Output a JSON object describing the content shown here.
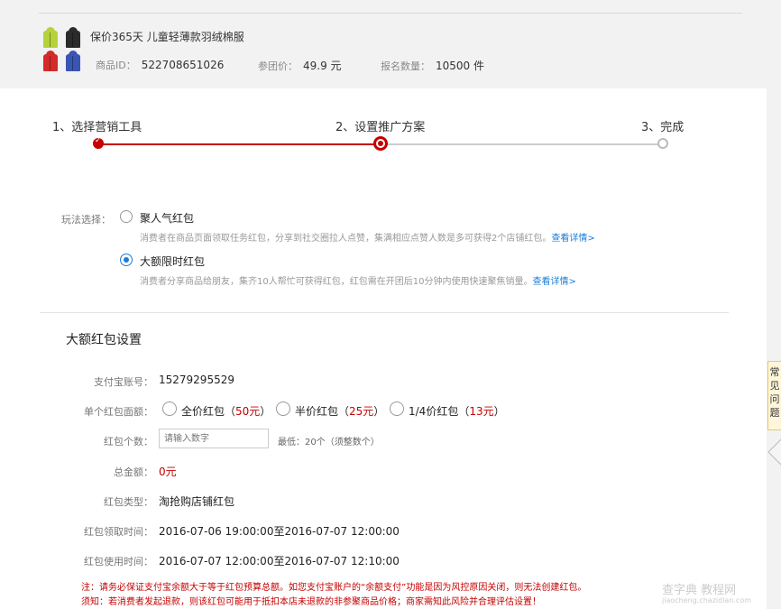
{
  "product": {
    "title": "保价365天 儿童轻薄款羽绒棉服",
    "id_label": "商品ID：",
    "id_value": "522708651026",
    "price_label": "参团价：",
    "price_value": "49.9 元",
    "count_label": "报名数量：",
    "count_value": "10500 件",
    "thumbnail": {
      "icon": "jacket-product-thumbnail",
      "colors": [
        "#b6d23a",
        "#2b2b2b",
        "#d42a2a",
        "#3a56b3"
      ]
    }
  },
  "steps": [
    {
      "label": "1、选择营销工具",
      "state": "done"
    },
    {
      "label": "2、设置推广方案",
      "state": "active"
    },
    {
      "label": "3、完成",
      "state": "todo"
    }
  ],
  "play": {
    "label": "玩法选择：",
    "options": [
      {
        "title": "聚人气红包",
        "selected": false,
        "desc": "消费者在商品页面领取任务红包，分享到社交圈拉人点赞，集满相应点赞人数是多可获得2个店铺红包。",
        "link": "查看详情>"
      },
      {
        "title": "大额限时红包",
        "selected": true,
        "desc": "消费者分享商品给朋友，集齐10人帮忙可获得红包，红包需在开团后10分钟内使用快速聚焦销量。",
        "link": "查看详情>"
      }
    ]
  },
  "settings": {
    "title": "大额红包设置",
    "alipay_label": "支付宝账号：",
    "alipay_value": "15279295529",
    "denom_label": "单个红包面额：",
    "denoms": [
      {
        "pre": "全价红包（",
        "amount": "50元",
        "post": "）"
      },
      {
        "pre": "半价红包（",
        "amount": "25元",
        "post": "）"
      },
      {
        "pre": "1/4价红包（",
        "amount": "13元",
        "post": "）"
      }
    ],
    "count_label": "红包个数：",
    "count_placeholder": "请输入数字",
    "count_hint": "最低：20个（须整数个）",
    "total_label": "总金额：",
    "total_value": "0元",
    "type_label": "红包类型：",
    "type_value": "淘抢购店铺红包",
    "receive_label": "红包领取时间：",
    "receive_value": "2016-07-06 19:00:00至2016-07-07 12:00:00",
    "use_label": "红包使用时间：",
    "use_value": "2016-07-07 12:00:00至2016-07-07 12:10:00"
  },
  "notes": [
    "注：请务必保证支付宝余额大于等于红包预算总额。如您支付宝账户的“余额支付”功能是因为风控原因关闭，则无法创建红包。",
    "须知：若消费者发起退款，则该红包可能用于抵扣本店未退款的非参聚商品价格；商家需知此风险并合理评估设置！"
  ],
  "side_tab": "常见问题",
  "watermark": "查字典 教程网",
  "watermark_url": "jiaocheng.chazidian.com",
  "colors": {
    "accent": "#c40000",
    "link": "#1a7cd6",
    "background": "#f2f2f2"
  }
}
